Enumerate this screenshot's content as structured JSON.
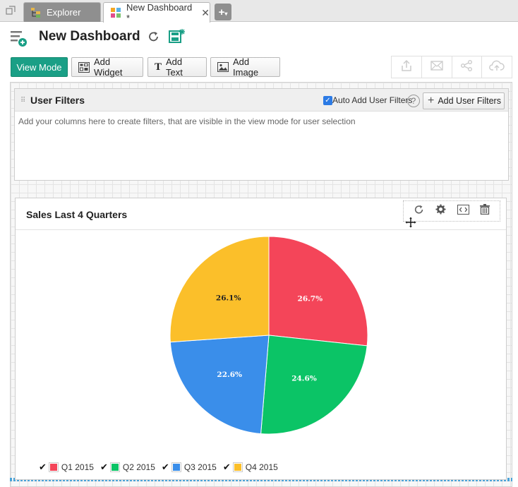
{
  "tabs": [
    {
      "label": "Explorer"
    },
    {
      "label": "New Dashboard *"
    }
  ],
  "header": {
    "title": "New Dashboard"
  },
  "toolbar": {
    "view_mode": "View Mode",
    "add_widget": "Add Widget",
    "add_text": "Add Text",
    "add_image": "Add Image"
  },
  "user_filters": {
    "title": "User Filters",
    "auto_add_label": "Auto Add User Filters",
    "auto_add_checked": true,
    "add_button": "Add User Filters",
    "hint": "Add your columns here to create filters, that are visible in the view mode for user selection"
  },
  "widget": {
    "title": "Sales Last 4 Quarters"
  },
  "colors": {
    "accent": "#1a9f86",
    "q1": "#f44559",
    "q2": "#0bc466",
    "q3": "#3a8eea",
    "q4": "#fbbf2a"
  },
  "chart_data": {
    "type": "pie",
    "title": "Sales Last 4 Quarters",
    "categories": [
      "Q1 2015",
      "Q2 2015",
      "Q3 2015",
      "Q4 2015"
    ],
    "values": [
      26.7,
      24.6,
      22.6,
      26.1
    ],
    "labels": [
      "26.7%",
      "24.6%",
      "22.6%",
      "26.1%"
    ],
    "colors": [
      "#f44559",
      "#0bc466",
      "#3a8eea",
      "#fbbf2a"
    ],
    "legend_placement": "bottom-left"
  }
}
